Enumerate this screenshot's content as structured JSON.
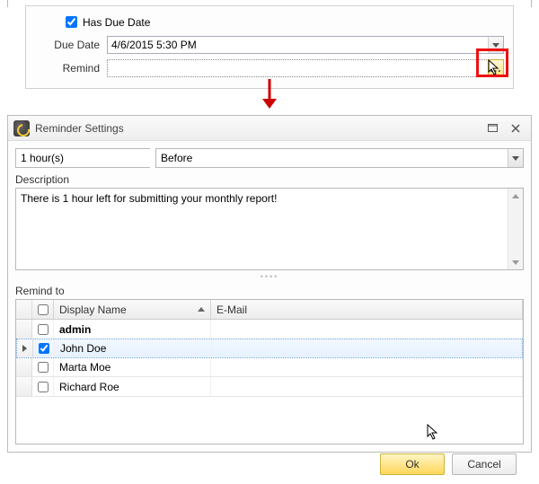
{
  "topPanel": {
    "hasDueDateLabel": "Has Due Date",
    "hasDueDateChecked": true,
    "dueDateLabel": "Due Date",
    "dueDateValue": "4/6/2015 5:30 PM",
    "remindLabel": "Remind",
    "remindValue": "",
    "ellipsis": "..."
  },
  "dialog": {
    "title": "Reminder Settings",
    "amount": "1 hour(s)",
    "relation": "Before",
    "descriptionLabel": "Description",
    "descriptionText": "There is 1 hour left for submitting your monthly report!",
    "remindToLabel": "Remind to",
    "columns": {
      "displayName": "Display Name",
      "email": "E-Mail"
    },
    "rows": [
      {
        "checked": false,
        "name": "admin",
        "email": "",
        "bold": true,
        "selected": false
      },
      {
        "checked": true,
        "name": "John Doe",
        "email": "",
        "bold": false,
        "selected": true
      },
      {
        "checked": false,
        "name": "Marta Moe",
        "email": "",
        "bold": false,
        "selected": false
      },
      {
        "checked": false,
        "name": "Richard Roe",
        "email": "",
        "bold": false,
        "selected": false
      }
    ],
    "okLabel": "Ok",
    "cancelLabel": "Cancel"
  },
  "colors": {
    "highlight": "#e11",
    "primaryBtn": "#ffd75a"
  }
}
